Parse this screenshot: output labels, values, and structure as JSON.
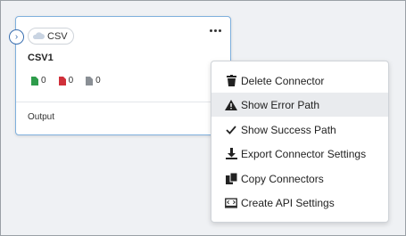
{
  "card": {
    "type_label": "CSV",
    "title": "CSV1",
    "stats": [
      {
        "icon": "green-file-icon",
        "count": "0",
        "color": "#2e9c4b"
      },
      {
        "icon": "red-file-icon",
        "count": "0",
        "color": "#d0303a"
      },
      {
        "icon": "gray-file-icon",
        "count": "0",
        "color": "#8a8f95"
      }
    ],
    "output_label": "Output"
  },
  "menu": {
    "items": [
      {
        "label": "Delete Connector",
        "icon": "trash-icon"
      },
      {
        "label": "Show Error Path",
        "icon": "warning-icon"
      },
      {
        "label": "Show Success Path",
        "icon": "check-icon"
      },
      {
        "label": "Export Connector Settings",
        "icon": "download-icon"
      },
      {
        "label": "Copy Connectors",
        "icon": "copy-icon"
      },
      {
        "label": "Create API Settings",
        "icon": "api-icon"
      }
    ],
    "highlighted_index": 1
  },
  "colors": {
    "accent": "#3a6fb0",
    "card_border": "#7fb0dd"
  }
}
